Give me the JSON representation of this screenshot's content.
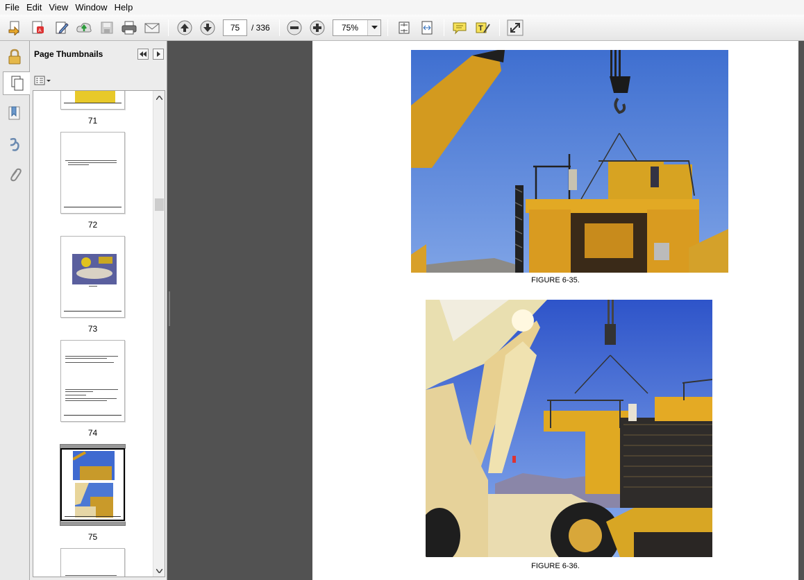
{
  "menu": [
    "File",
    "Edit",
    "View",
    "Window",
    "Help"
  ],
  "toolbar": {
    "page_current": "75",
    "page_total": "/ 336",
    "zoom": "75%"
  },
  "thumbnails_panel": {
    "title": "Page Thumbnails",
    "pages": [
      {
        "number": "71"
      },
      {
        "number": "72"
      },
      {
        "number": "73"
      },
      {
        "number": "74"
      },
      {
        "number": "75",
        "selected": true
      }
    ]
  },
  "document": {
    "captions": [
      "FIGURE 6-35.",
      "FIGURE 6-36."
    ]
  },
  "colors": {
    "accent_yellow": "#e8b325",
    "sky_blue": "#4f7fd0"
  }
}
